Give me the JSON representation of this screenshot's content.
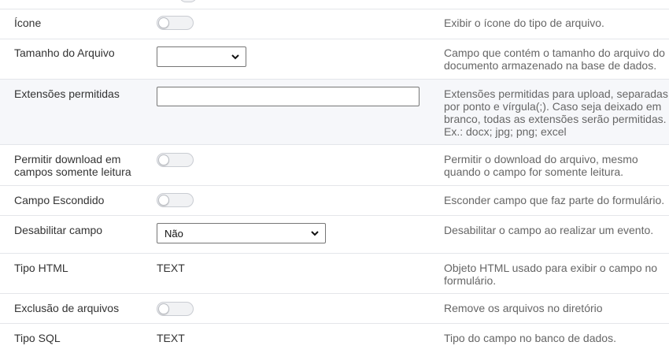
{
  "rows": [
    {
      "label": "Ícone",
      "control": "toggle",
      "description": "Exibir o ícone do tipo de arquivo."
    },
    {
      "label": "Tamanho do Arquivo",
      "control": "select",
      "selected_value": "",
      "description": "Campo que contém o tamanho do arquivo do documento armazenado na base de dados."
    },
    {
      "label": "Extensões permitidas",
      "control": "text",
      "value": "",
      "description": "Extensões permitidas para upload, separadas por ponto e vírgula(;). Caso seja deixado em branco, todas as extensões serão permitidas. Ex.: docx; jpg; png; excel"
    },
    {
      "label": "Permitir download em campos somente leitura",
      "control": "toggle",
      "description": "Permitir o download do arquivo, mesmo quando o campo for somente leitura."
    },
    {
      "label": "Campo Escondido",
      "control": "toggle",
      "description": "Esconder campo que faz parte do formulário."
    },
    {
      "label": "Desabilitar campo",
      "control": "select",
      "selected_value": "Não",
      "description": "Desabilitar o campo ao realizar um evento."
    },
    {
      "label": "Tipo HTML",
      "control": "plain",
      "value": "TEXT",
      "description": "Objeto HTML usado para exibir o campo no formulário."
    },
    {
      "label": "Exclusão de arquivos",
      "control": "toggle",
      "description": "Remove os arquivos no diretório"
    },
    {
      "label": "Tipo SQL",
      "control": "plain",
      "value": "TEXT",
      "description": "Tipo do campo no banco de dados."
    }
  ]
}
